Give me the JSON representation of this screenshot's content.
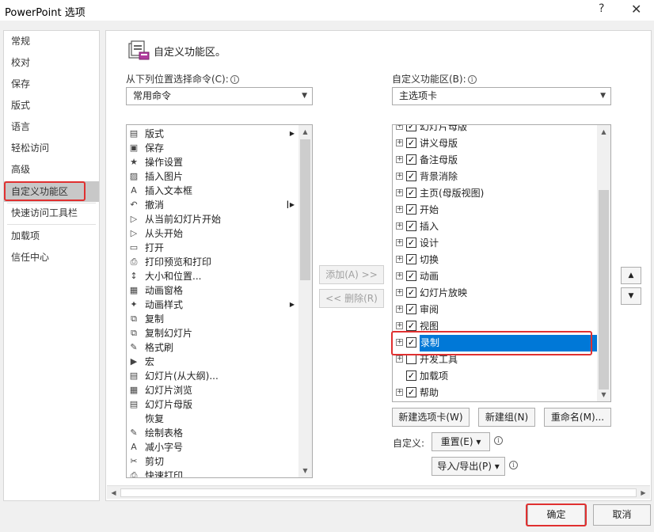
{
  "window": {
    "title": "PowerPoint 选项",
    "help": "?",
    "close": "✕"
  },
  "nav": {
    "items": [
      "常规",
      "校对",
      "保存",
      "版式",
      "语言",
      "轻松访问",
      "高级",
      "自定义功能区",
      "快速访问工具栏",
      "加载项",
      "信任中心"
    ],
    "selected": "自定义功能区"
  },
  "header": {
    "title": "自定义功能区。"
  },
  "left": {
    "label": "从下列位置选择命令(C):",
    "dropdown": "常用命令",
    "commands": [
      {
        "label": "版式",
        "icon": "layout-icon",
        "glyph": "▤",
        "submenu": true
      },
      {
        "label": "保存",
        "icon": "save-icon",
        "glyph": "▣"
      },
      {
        "label": "操作设置",
        "icon": "star-icon",
        "glyph": "★"
      },
      {
        "label": "插入图片",
        "icon": "picture-icon",
        "glyph": "▨"
      },
      {
        "label": "插入文本框",
        "icon": "textbox-icon",
        "glyph": "A"
      },
      {
        "label": "撤消",
        "icon": "undo-icon",
        "glyph": "↶",
        "submenu2": true
      },
      {
        "label": "从当前幻灯片开始",
        "icon": "slideshow-current-icon",
        "glyph": "▷"
      },
      {
        "label": "从头开始",
        "icon": "slideshow-start-icon",
        "glyph": "▷"
      },
      {
        "label": "打开",
        "icon": "folder-icon",
        "glyph": "▭"
      },
      {
        "label": "打印预览和打印",
        "icon": "print-icon",
        "glyph": "⎙"
      },
      {
        "label": "大小和位置...",
        "icon": "size-icon",
        "glyph": "↕"
      },
      {
        "label": "动画窗格",
        "icon": "animation-pane-icon",
        "glyph": "▦"
      },
      {
        "label": "动画样式",
        "icon": "animation-style-icon",
        "glyph": "✦",
        "submenu": true
      },
      {
        "label": "复制",
        "icon": "copy-icon",
        "glyph": "⧉"
      },
      {
        "label": "复制幻灯片",
        "icon": "duplicate-slide-icon",
        "glyph": "⧉"
      },
      {
        "label": "格式刷",
        "icon": "format-painter-icon",
        "glyph": "✎"
      },
      {
        "label": "宏",
        "icon": "macro-icon",
        "glyph": "▶"
      },
      {
        "label": "幻灯片(从大纲)...",
        "icon": "slide-outline-icon",
        "glyph": "▤"
      },
      {
        "label": "幻灯片浏览",
        "icon": "slide-sorter-icon",
        "glyph": "▦"
      },
      {
        "label": "幻灯片母版",
        "icon": "slide-master-icon",
        "glyph": "▤"
      },
      {
        "label": "恢复",
        "icon": "blank-icon",
        "glyph": ""
      },
      {
        "label": "绘制表格",
        "icon": "draw-table-icon",
        "glyph": "✎"
      },
      {
        "label": "减小字号",
        "icon": "font-decrease-icon",
        "glyph": "A"
      },
      {
        "label": "剪切",
        "icon": "cut-icon",
        "glyph": "✂"
      },
      {
        "label": "快速打印",
        "icon": "quick-print-icon",
        "glyph": "⎙"
      }
    ]
  },
  "middle": {
    "add": "添加(A) >>",
    "remove": "<< 删除(R)"
  },
  "right": {
    "label": "自定义功能区(B):",
    "dropdown": "主选项卡",
    "tabs": [
      {
        "label": "幻灯片母版",
        "expand": true,
        "checked": true
      },
      {
        "label": "讲义母版",
        "expand": true,
        "checked": true
      },
      {
        "label": "备注母版",
        "expand": true,
        "checked": true
      },
      {
        "label": "背景消除",
        "expand": true,
        "checked": true
      },
      {
        "label": "主页(母版视图)",
        "expand": true,
        "checked": true
      },
      {
        "label": "开始",
        "expand": true,
        "checked": true
      },
      {
        "label": "插入",
        "expand": true,
        "checked": true
      },
      {
        "label": "设计",
        "expand": true,
        "checked": true
      },
      {
        "label": "切换",
        "expand": true,
        "checked": true
      },
      {
        "label": "动画",
        "expand": true,
        "checked": true
      },
      {
        "label": "幻灯片放映",
        "expand": true,
        "checked": true
      },
      {
        "label": "审阅",
        "expand": true,
        "checked": true
      },
      {
        "label": "视图",
        "expand": true,
        "checked": true
      },
      {
        "label": "录制",
        "expand": true,
        "checked": true,
        "selected": true
      },
      {
        "label": "开发工具",
        "expand": true,
        "checked": false
      },
      {
        "label": "加载项",
        "expand": false,
        "checked": true
      },
      {
        "label": "帮助",
        "expand": true,
        "checked": true
      }
    ],
    "new_tab": "新建选项卡(W)",
    "new_group": "新建组(N)",
    "rename": "重命名(M)...",
    "customize_label": "自定义:",
    "reset": "重置(E) ▾",
    "import_export": "导入/导出(P) ▾"
  },
  "footer": {
    "ok": "确定",
    "cancel": "取消"
  },
  "colors": {
    "accent": "#0078d7",
    "highlight_box": "#e03030"
  }
}
